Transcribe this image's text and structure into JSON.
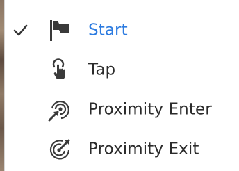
{
  "menu": {
    "items": [
      {
        "label": "Start",
        "icon": "flag-icon",
        "selected": true
      },
      {
        "label": "Tap",
        "icon": "tap-gesture-icon",
        "selected": false
      },
      {
        "label": "Proximity Enter",
        "icon": "proximity-enter-icon",
        "selected": false
      },
      {
        "label": "Proximity Exit",
        "icon": "proximity-exit-icon",
        "selected": false
      }
    ]
  },
  "colors": {
    "selected_text": "#2c7be0",
    "text": "#2b2b2b",
    "icon": "#3a3a3a"
  }
}
